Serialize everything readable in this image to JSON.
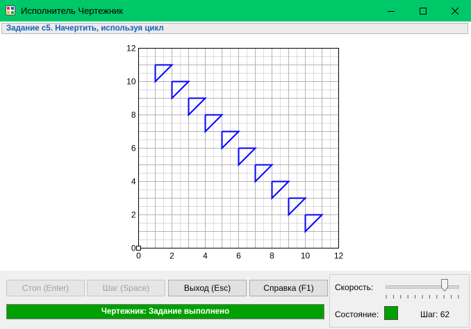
{
  "window": {
    "title": "Исполнитель Чертежник",
    "accent_color": "#00c868"
  },
  "task": {
    "text": "Задание c5. Начертить, используя цикл"
  },
  "chart_data": {
    "type": "line",
    "xlim": [
      0,
      12
    ],
    "ylim": [
      0,
      12
    ],
    "grid": true,
    "minor_step": 0.5,
    "x_tick_labels": [
      "0",
      "2",
      "4",
      "6",
      "8",
      "10",
      "12"
    ],
    "y_tick_labels": [
      "0",
      "2",
      "4",
      "6",
      "8",
      "10",
      "12"
    ],
    "shape_color": "#0000ff",
    "shapes": [
      [
        [
          1,
          11
        ],
        [
          2,
          11
        ],
        [
          1,
          10
        ],
        [
          1,
          11
        ]
      ],
      [
        [
          2,
          10
        ],
        [
          3,
          10
        ],
        [
          2,
          9
        ],
        [
          2,
          10
        ]
      ],
      [
        [
          3,
          9
        ],
        [
          4,
          9
        ],
        [
          3,
          8
        ],
        [
          3,
          9
        ]
      ],
      [
        [
          4,
          8
        ],
        [
          5,
          8
        ],
        [
          4,
          7
        ],
        [
          4,
          8
        ]
      ],
      [
        [
          5,
          7
        ],
        [
          6,
          7
        ],
        [
          5,
          6
        ],
        [
          5,
          7
        ]
      ],
      [
        [
          6,
          6
        ],
        [
          7,
          6
        ],
        [
          6,
          5
        ],
        [
          6,
          6
        ]
      ],
      [
        [
          7,
          5
        ],
        [
          8,
          5
        ],
        [
          7,
          4
        ],
        [
          7,
          5
        ]
      ],
      [
        [
          8,
          4
        ],
        [
          9,
          4
        ],
        [
          8,
          3
        ],
        [
          8,
          4
        ]
      ],
      [
        [
          9,
          3
        ],
        [
          10,
          3
        ],
        [
          9,
          2
        ],
        [
          9,
          3
        ]
      ],
      [
        [
          10,
          2
        ],
        [
          11,
          2
        ],
        [
          10,
          1
        ],
        [
          10,
          2
        ]
      ]
    ]
  },
  "buttons": {
    "stop": "Стоп (Enter)",
    "step": "Шаг (Space)",
    "exit": "Выход (Esc)",
    "help": "Справка (F1)"
  },
  "status": {
    "message": "Чертежник: Задание выполнено",
    "color": "#00a000"
  },
  "speed": {
    "label": "Скорость:",
    "level_fraction": 0.82
  },
  "state": {
    "label": "Состояние:",
    "step_counter": "Шаг: 62"
  },
  "icons": [
    "app-icon",
    "minimize-icon",
    "maximize-icon",
    "close-icon"
  ]
}
